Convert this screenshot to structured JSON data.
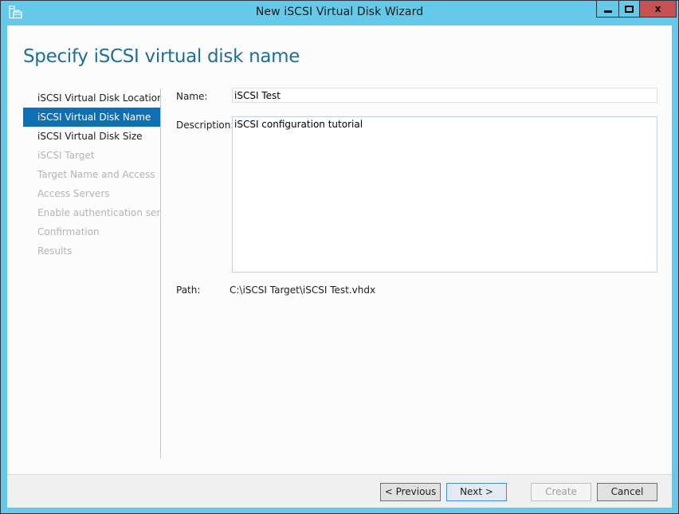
{
  "window": {
    "title": "New iSCSI Virtual Disk Wizard",
    "icon": "server-manager-icon",
    "controls": {
      "minimize": "minimize",
      "maximize": "maximize",
      "close": "x"
    }
  },
  "page": {
    "title": "Specify iSCSI virtual disk name"
  },
  "steps": [
    {
      "label": "iSCSI Virtual Disk Location",
      "state": "enabled"
    },
    {
      "label": "iSCSI Virtual Disk Name",
      "state": "active"
    },
    {
      "label": "iSCSI Virtual Disk Size",
      "state": "enabled"
    },
    {
      "label": "iSCSI Target",
      "state": "disabled"
    },
    {
      "label": "Target Name and Access",
      "state": "disabled"
    },
    {
      "label": "Access Servers",
      "state": "disabled"
    },
    {
      "label": "Enable authentication ser...",
      "state": "disabled"
    },
    {
      "label": "Confirmation",
      "state": "disabled"
    },
    {
      "label": "Results",
      "state": "disabled"
    }
  ],
  "form": {
    "name_label": "Name:",
    "name_value": "iSCSI Test",
    "description_label": "Description:",
    "description_value": "iSCSI configuration tutorial",
    "path_label": "Path:",
    "path_value": "C:\\iSCSI Target\\iSCSI Test.vhdx"
  },
  "footer": {
    "previous_label": "< Previous",
    "next_label": "Next >",
    "create_label": "Create",
    "cancel_label": "Cancel"
  },
  "colors": {
    "frame": "#65c9ea",
    "accent": "#0f6fb5",
    "title_text": "#1e6e9c",
    "close_button": "#c75050"
  }
}
